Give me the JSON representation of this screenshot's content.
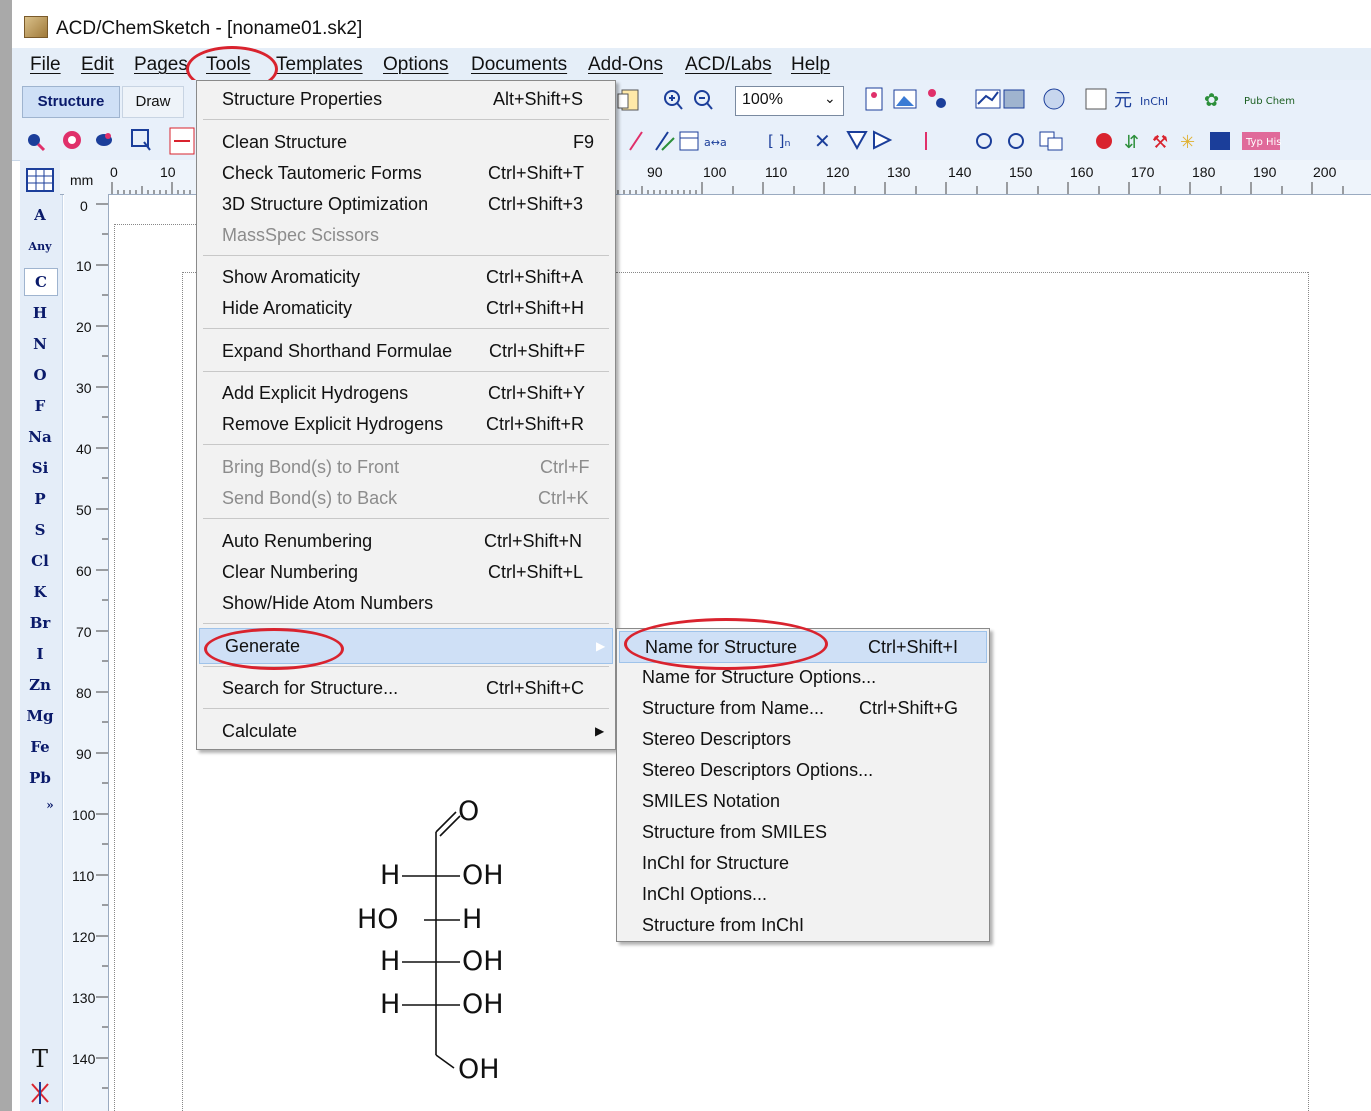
{
  "window": {
    "title": "ACD/ChemSketch - [noname01.sk2]"
  },
  "menubar": [
    "File",
    "Edit",
    "Pages",
    "Tools",
    "Templates",
    "Options",
    "Documents",
    "Add-Ons",
    "ACD/Labs",
    "Help"
  ],
  "toolbar": {
    "mode_structure": "Structure",
    "mode_draw": "Draw",
    "zoom": "100%",
    "chem_logo_text": "Pub Chem",
    "typ_his": "Typ His"
  },
  "ruler": {
    "unit": "mm",
    "top_left": [
      "0",
      "10"
    ],
    "top_right": [
      "90",
      "100",
      "110",
      "120",
      "130",
      "140",
      "150",
      "160",
      "170",
      "180",
      "190",
      "200"
    ],
    "left": [
      "0",
      "10",
      "20",
      "30",
      "40",
      "50",
      "60",
      "70",
      "80",
      "90",
      "100",
      "110",
      "120",
      "130",
      "140"
    ]
  },
  "atoms": [
    "A",
    "Any",
    "C",
    "H",
    "N",
    "O",
    "F",
    "Na",
    "Si",
    "P",
    "S",
    "Cl",
    "K",
    "Br",
    "I",
    "Zn",
    "Mg",
    "Fe",
    "Pb",
    "»"
  ],
  "atombar_bottom": {
    "text_tool": "T"
  },
  "tools_menu": {
    "items": [
      {
        "label": "Structure Properties",
        "shortcut": "Alt+Shift+S",
        "disabled": false
      },
      {
        "label": "Clean Structure",
        "shortcut": "F9",
        "disabled": false
      },
      {
        "label": "Check Tautomeric Forms",
        "shortcut": "Ctrl+Shift+T",
        "disabled": false
      },
      {
        "label": "3D Structure Optimization",
        "shortcut": "Ctrl+Shift+3",
        "disabled": false
      },
      {
        "label": "MassSpec Scissors",
        "shortcut": "",
        "disabled": true
      },
      {
        "label": "Show Aromaticity",
        "shortcut": "Ctrl+Shift+A",
        "disabled": false
      },
      {
        "label": "Hide Aromaticity",
        "shortcut": "Ctrl+Shift+H",
        "disabled": false
      },
      {
        "label": "Expand Shorthand Formulae",
        "shortcut": "Ctrl+Shift+F",
        "disabled": false
      },
      {
        "label": "Add Explicit Hydrogens",
        "shortcut": "Ctrl+Shift+Y",
        "disabled": false
      },
      {
        "label": "Remove Explicit Hydrogens",
        "shortcut": "Ctrl+Shift+R",
        "disabled": false
      },
      {
        "label": "Bring Bond(s) to Front",
        "shortcut": "Ctrl+F",
        "disabled": true
      },
      {
        "label": "Send Bond(s) to Back",
        "shortcut": "Ctrl+K",
        "disabled": true
      },
      {
        "label": "Auto Renumbering",
        "shortcut": "Ctrl+Shift+N",
        "disabled": false
      },
      {
        "label": "Clear Numbering",
        "shortcut": "Ctrl+Shift+L",
        "disabled": false
      },
      {
        "label": "Show/Hide Atom Numbers",
        "shortcut": "",
        "disabled": false
      },
      {
        "label": "Generate",
        "shortcut": "",
        "disabled": false
      },
      {
        "label": "Search for Structure...",
        "shortcut": "Ctrl+Shift+C",
        "disabled": false
      },
      {
        "label": "Calculate",
        "shortcut": "",
        "disabled": false
      }
    ]
  },
  "generate_submenu": {
    "items": [
      {
        "label": "Name for Structure",
        "shortcut": "Ctrl+Shift+I"
      },
      {
        "label": "Name for Structure Options...",
        "shortcut": ""
      },
      {
        "label": "Structure from Name...",
        "shortcut": "Ctrl+Shift+G"
      },
      {
        "label": "Stereo Descriptors",
        "shortcut": ""
      },
      {
        "label": "Stereo Descriptors Options...",
        "shortcut": ""
      },
      {
        "label": "SMILES Notation",
        "shortcut": ""
      },
      {
        "label": "Structure from SMILES",
        "shortcut": ""
      },
      {
        "label": "InChI for Structure",
        "shortcut": ""
      },
      {
        "label": "InChI Options...",
        "shortcut": ""
      },
      {
        "label": "Structure from InChI",
        "shortcut": ""
      }
    ]
  },
  "molecule": {
    "top_o": "O",
    "rows": [
      {
        "left": "H",
        "right": "OH"
      },
      {
        "left": "HO",
        "right": "H"
      },
      {
        "left": "H",
        "right": "OH"
      },
      {
        "left": "H",
        "right": "OH"
      }
    ],
    "bottom": "OH"
  },
  "colors": {
    "highlight_ellipse": "#d9232e",
    "menu_highlight": "#cfe0f6",
    "toolbar_bg": "#e8f0fa"
  }
}
